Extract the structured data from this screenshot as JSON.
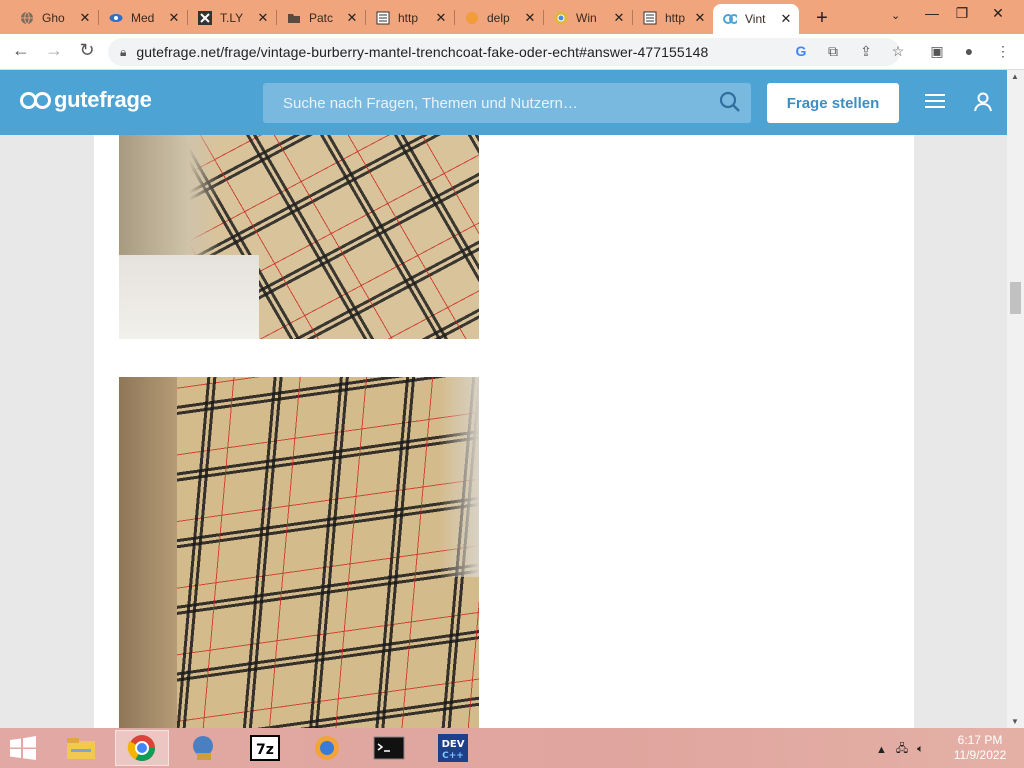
{
  "browser": {
    "tabs": [
      {
        "title": "Gho",
        "icon": "globe-icon"
      },
      {
        "title": "Med",
        "icon": "medium-icon"
      },
      {
        "title": "T.LY",
        "icon": "tly-icon"
      },
      {
        "title": "Patc",
        "icon": "folder-icon"
      },
      {
        "title": "http",
        "icon": "page-icon"
      },
      {
        "title": "delp",
        "icon": "delp-icon"
      },
      {
        "title": "Win",
        "icon": "chrome-icon"
      },
      {
        "title": "http",
        "icon": "page-icon"
      },
      {
        "title": "Vint",
        "icon": "gutefrage-icon",
        "active": true
      }
    ],
    "url": "gutefrage.net/frage/vintage-burberry-mantel-trenchcoat-fake-oder-echt#answer-477155148"
  },
  "site": {
    "brand": "gutefrage",
    "search_placeholder": "Suche nach Fragen, Themen und Nutzern…",
    "ask_button": "Frage stellen",
    "colors": {
      "header": "#4da3d4",
      "accent": "#3a8fc4"
    }
  },
  "content": {
    "images": [
      {
        "alt": "burberry-check-lining-photo-1"
      },
      {
        "alt": "burberry-check-lining-photo-2"
      }
    ]
  },
  "taskbar": {
    "apps": [
      "file-explorer-icon",
      "chrome-icon",
      "network-icon",
      "7zip-icon",
      "firefox-icon",
      "terminal-icon",
      "devc-icon"
    ],
    "active_app": "chrome-icon",
    "time": "6:17 PM",
    "date": "11/9/2022"
  }
}
